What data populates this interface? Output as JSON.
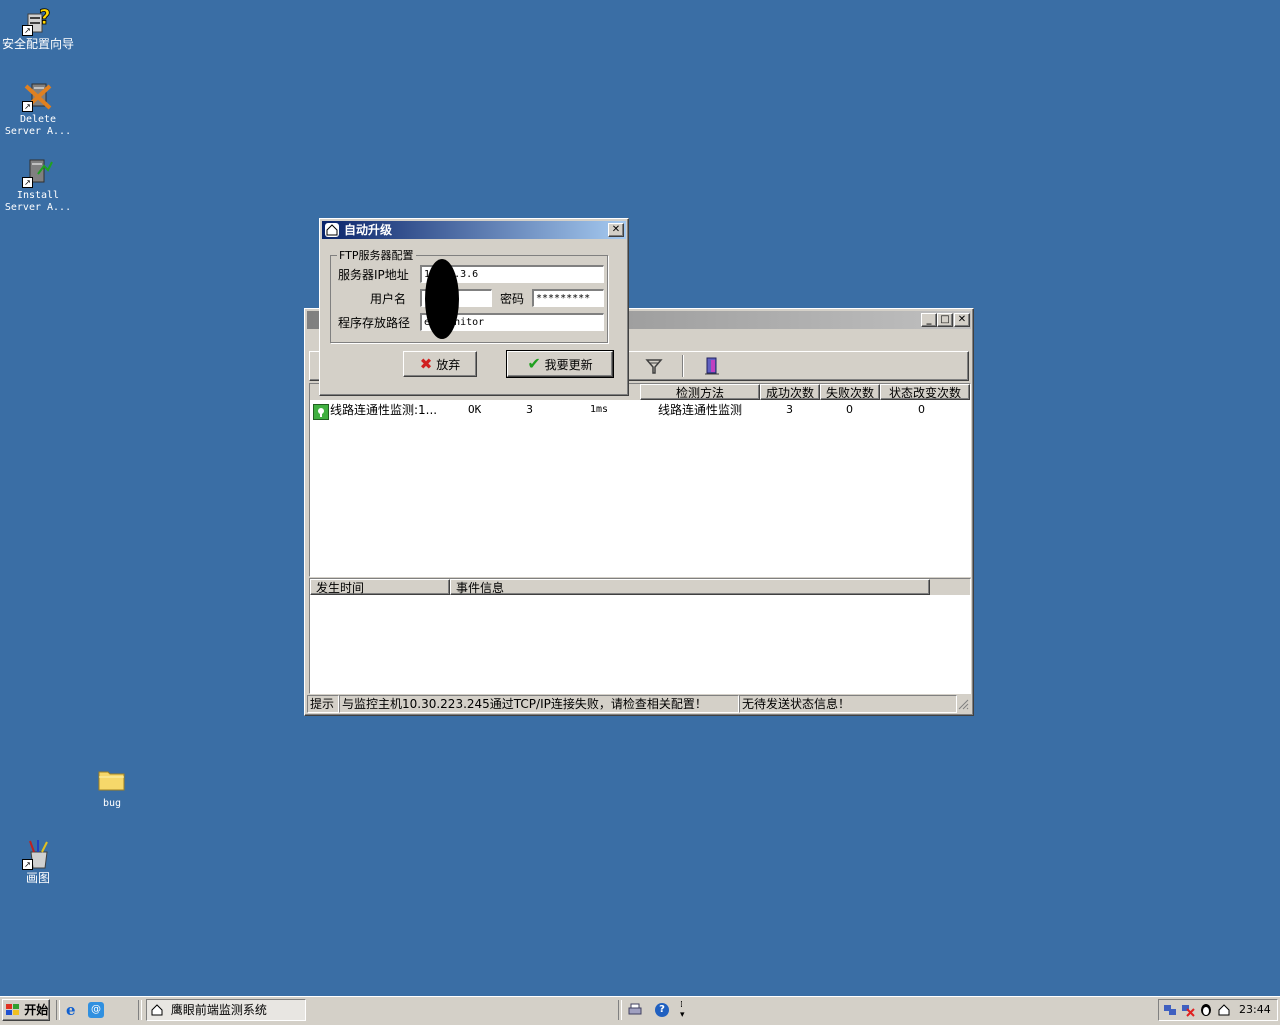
{
  "desktop": {
    "icons": [
      {
        "label": "安全配置向导",
        "icon": "security-wizard-icon"
      },
      {
        "label": "Delete Server A...",
        "icon": "delete-server-icon"
      },
      {
        "label": "Install Server A...",
        "icon": "install-server-icon"
      },
      {
        "label": "bug",
        "icon": "folder-icon"
      },
      {
        "label": "画图",
        "icon": "paint-icon"
      }
    ]
  },
  "main_window": {
    "title": "",
    "columns": [
      "检测方法",
      "成功次数",
      "失败次数",
      "状态改变次数"
    ],
    "rows": [
      {
        "name": "线路连通性监测:1...",
        "status": "OK",
        "count": "3",
        "time": "1ms",
        "method": "线路连通性监测",
        "success": "3",
        "fail": "0",
        "change": "0"
      }
    ],
    "event_columns": [
      "发生时间",
      "事件信息"
    ],
    "status": {
      "label": "提示",
      "message": "与监控主机10.30.223.245通过TCP/IP连接失败，请检查相关配置！",
      "right": "无待发送状态信息！"
    }
  },
  "dialog": {
    "title": "自动升级",
    "group_label": "FTP服务器配置",
    "ip_label": "服务器IP地址",
    "ip_value": "10.30.3.6",
    "user_label": "用户名",
    "user_value": "",
    "password_label": "密码",
    "password_value": "*********",
    "path_label": "程序存放路径",
    "path_value": "eyemonitor",
    "cancel_label": "放弃",
    "ok_label": "我要更新"
  },
  "taskbar": {
    "start_label": "开始",
    "task_label": "鹰眼前端监测系统",
    "clock": "23:44"
  },
  "colors": {
    "desktop": "#3a6ea5",
    "face": "#d4d0c8",
    "title_active": "#0a246a"
  }
}
